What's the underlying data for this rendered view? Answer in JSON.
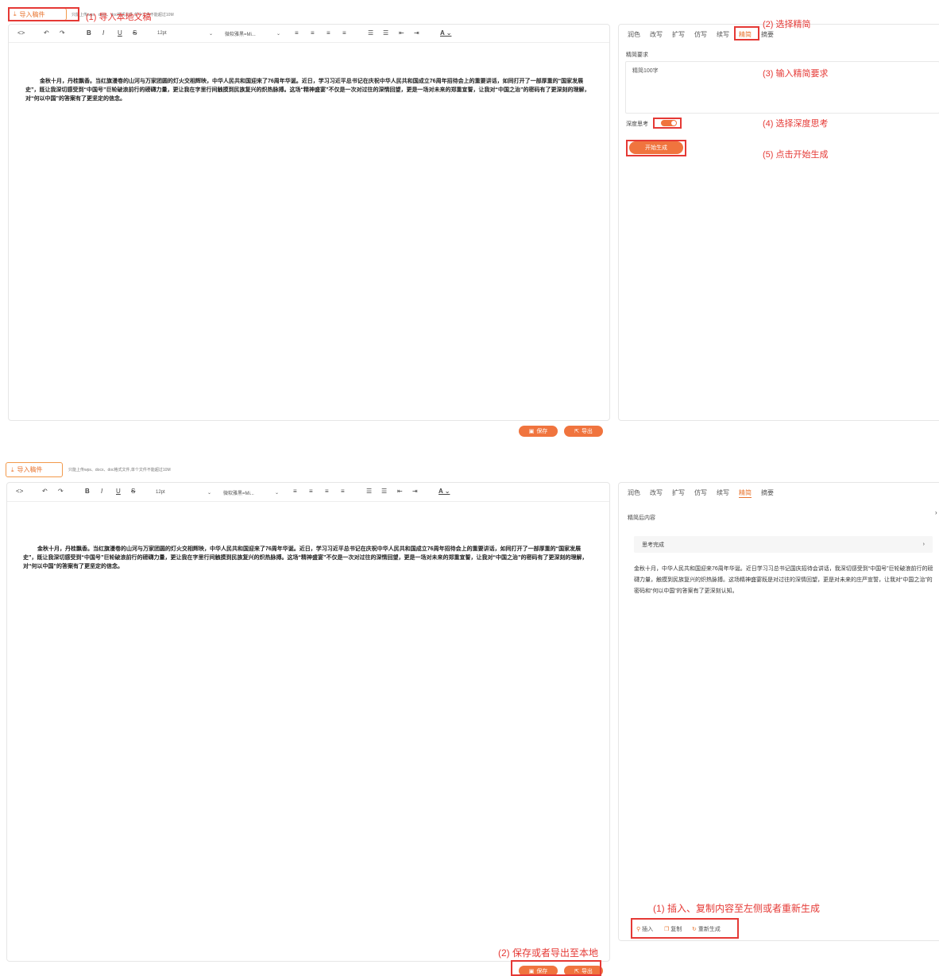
{
  "top": {
    "upload_label": "导入稿件",
    "upload_hint": "只能上传wps、docx、doc格式文件,单个文件不能超过10M",
    "toolbar": {
      "code": "<>",
      "bold": "B",
      "italic": "I",
      "underline": "U",
      "strike": "S",
      "font_size": "12pt",
      "font_family": "微软雅黑=Mi...",
      "color": "A"
    },
    "doc_text": "金秋十月，丹桂飘香。当红旗漫卷的山河与万家团圆的灯火交相辉映，中华人民共和国迎来了76周年华诞。近日，学习习近平总书记在庆祝中华人民共和国成立76周年招待会上的重要讲话，如同打开了一部厚重的“国家发展史”，既让我深切感受到“中国号”巨轮破浪前行的磅礴力量，更让我在字里行间触摸到民族复兴的炽热脉搏。这场“精神盛宴”不仅是一次对过往的深情回望，更是一场对未来的郑重宣誓，让我对“中国之治”的密码有了更深刻的理解，对“何以中国”的答案有了更坚定的信念。",
    "tabs": [
      "润色",
      "改写",
      "扩写",
      "仿写",
      "续写",
      "精简",
      "摘要"
    ],
    "active_tab": "精简",
    "req_label": "精简要求",
    "req_value": "精简100字",
    "deep_label": "深度思考",
    "generate_label": "开始生成",
    "save_label": "保存",
    "export_label": "导出",
    "annotations": {
      "a1": "(1) 导入本地文稿",
      "a2": "(2) 选择精简",
      "a3": "(3) 输入精简要求",
      "a4": "(4) 选择深度思考",
      "a5": "(5) 点击开始生成"
    }
  },
  "bottom": {
    "upload_label": "导入稿件",
    "upload_hint": "只能上传wps、docx、doc格式文件,单个文件不能超过10M",
    "toolbar": {
      "code": "<>",
      "bold": "B",
      "italic": "I",
      "underline": "U",
      "strike": "S",
      "font_size": "12pt",
      "font_family": "微软雅黑=Mi...",
      "color": "A"
    },
    "doc_text": "金秋十月，丹桂飘香。当红旗漫卷的山河与万家团圆的灯火交相辉映，中华人民共和国迎来了76周年华诞。近日，学习习近平总书记在庆祝中华人民共和国成立76周年招待会上的重要讲话，如同打开了一部厚重的“国家发展史”，既让我深切感受到“中国号”巨轮破浪前行的磅礴力量，更让我在字里行间触摸到民族复兴的炽热脉搏。这场“精神盛宴”不仅是一次对过往的深情回望，更是一场对未来的郑重宣誓，让我对“中国之治”的密码有了更深刻的理解，对“何以中国”的答案有了更坚定的信念。",
    "tabs": [
      "润色",
      "改写",
      "扩写",
      "仿写",
      "续写",
      "精简",
      "摘要"
    ],
    "active_tab": "精简",
    "result_label": "精简后内容",
    "think_label": "思考完成",
    "result_text": "金秋十月，中华人民共和国迎来76周年华诞。近日学习习总书记国庆招待会讲话，我深切感受到“中国号”巨轮破浪前行的磅礴力量，触摸到民族复兴的炽热脉搏。这场精神盛宴既是对过往的深情回望，更是对未来的庄严宣誓，让我对“中国之治”的密码和“何以中国”的答案有了更深刻认知。",
    "insert_label": "插入",
    "copy_label": "复制",
    "regen_label": "重新生成",
    "save_label": "保存",
    "export_label": "导出",
    "annotations": {
      "a1": "(1) 插入、复制内容至左侧或者重新生成",
      "a2": "(2) 保存或者导出至本地"
    }
  },
  "colors": {
    "accent": "#f0743e",
    "annotation": "#e53935"
  }
}
